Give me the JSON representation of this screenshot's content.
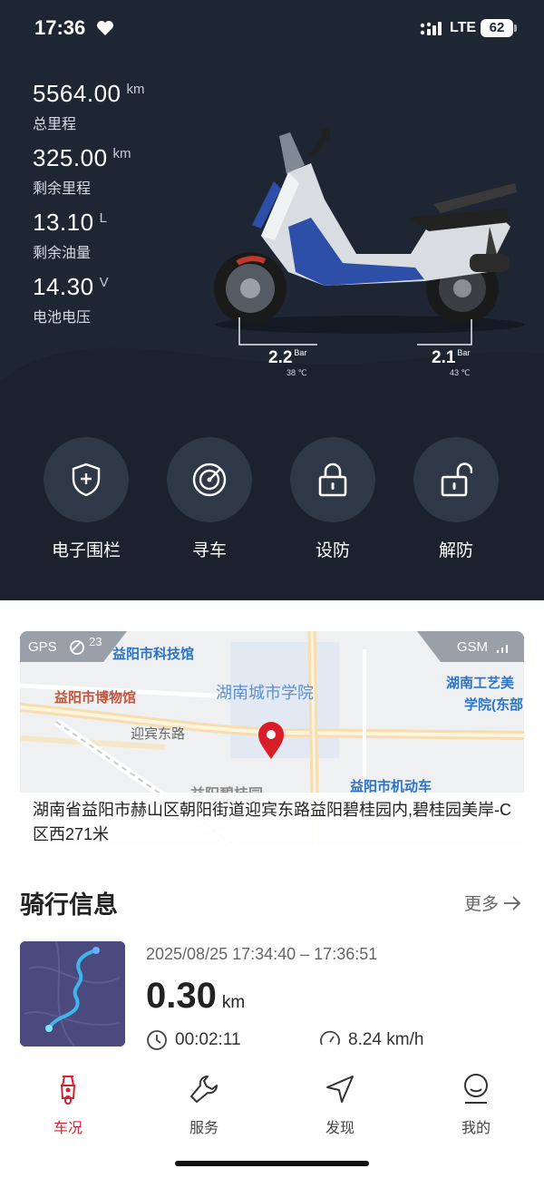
{
  "status_bar": {
    "time": "17:36",
    "network": "LTE",
    "battery": "62"
  },
  "stats": [
    {
      "value": "5564.00",
      "unit": "km",
      "label": "总里程"
    },
    {
      "value": "325.00",
      "unit": "km",
      "label": "剩余里程"
    },
    {
      "value": "13.10",
      "unit": "L",
      "label": "剩余油量"
    },
    {
      "value": "14.30",
      "unit": "V",
      "label": "电池电压"
    }
  ],
  "tires": {
    "front": {
      "pressure": "2.2",
      "unit": "Bar",
      "temp": "38 ℃"
    },
    "rear": {
      "pressure": "2.1",
      "unit": "Bar",
      "temp": "43 ℃"
    }
  },
  "actions": [
    {
      "label": "电子围栏",
      "icon": "shield-plus-icon"
    },
    {
      "label": "寻车",
      "icon": "radar-icon"
    },
    {
      "label": "设防",
      "icon": "lock-icon"
    },
    {
      "label": "解防",
      "icon": "unlock-icon"
    }
  ],
  "map": {
    "gps_label": "GPS",
    "gps_count": "23",
    "gsm_label": "GSM",
    "pois": {
      "tech_museum": "益阳市科技馆",
      "museum": "益阳市博物馆",
      "college": "湖南城市学院",
      "road": "迎宾东路",
      "arts_college_1": "湖南工艺美",
      "arts_college_2": "学院(东部",
      "garden": "益阳碧桂园",
      "dmv": "益阳市机动车"
    },
    "address": "湖南省益阳市赫山区朝阳街道迎宾东路益阳碧桂园内,碧桂园美岸-C区西271米"
  },
  "ride": {
    "title": "骑行信息",
    "more": "更多",
    "time_range": "2025/08/25 17:34:40 – 17:36:51",
    "distance": "0.30",
    "distance_unit": "km",
    "duration": "00:02:11",
    "avg_speed": "8.24 km/h"
  },
  "tabs": [
    {
      "label": "车况",
      "icon": "scooter-icon",
      "active": true
    },
    {
      "label": "服务",
      "icon": "wrench-icon",
      "active": false
    },
    {
      "label": "发现",
      "icon": "navigation-icon",
      "active": false
    },
    {
      "label": "我的",
      "icon": "profile-icon",
      "active": false
    }
  ],
  "colors": {
    "header_bg": "#1e2633",
    "accent": "#d3232e",
    "action_bg": "#2e3846"
  }
}
